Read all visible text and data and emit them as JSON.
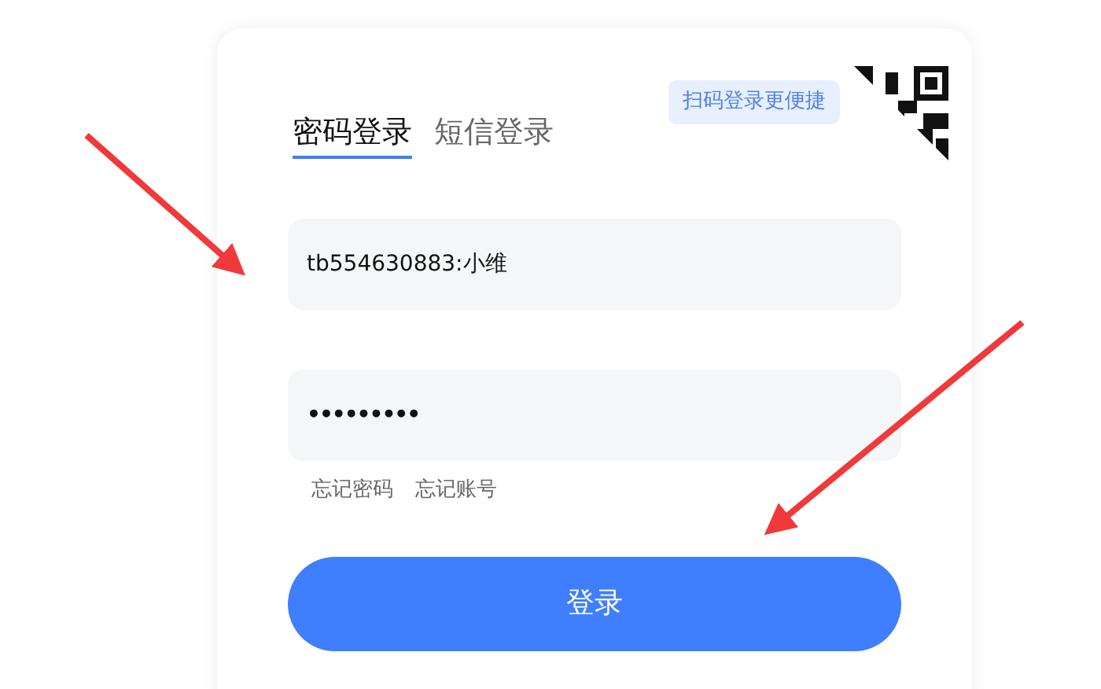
{
  "tabs": [
    {
      "label": "密码登录",
      "selected": true
    },
    {
      "label": "短信登录",
      "selected": false
    }
  ],
  "qr_hint": "扫码登录更便捷",
  "fields": [
    {
      "kind": "text",
      "value": "tb554630883:小维"
    },
    {
      "kind": "password",
      "value": "•••••••••"
    }
  ],
  "links": [
    "忘记密码",
    "忘记账号"
  ],
  "login_button": "登录"
}
